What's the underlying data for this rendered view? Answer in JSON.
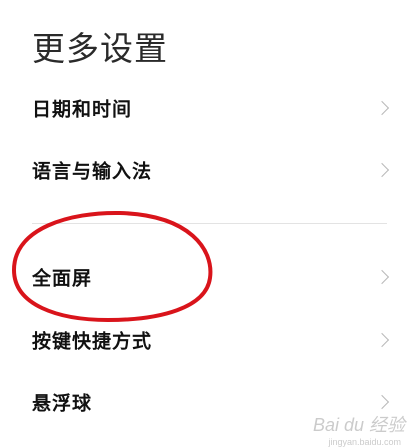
{
  "page": {
    "title": "更多设置"
  },
  "settings": {
    "items": [
      {
        "label": "日期和时间",
        "icon": "chevron-right-icon"
      },
      {
        "label": "语言与输入法",
        "icon": "chevron-right-icon"
      },
      {
        "label": "全面屏",
        "icon": "chevron-right-icon"
      },
      {
        "label": "按键快捷方式",
        "icon": "chevron-right-icon"
      },
      {
        "label": "悬浮球",
        "icon": "chevron-right-icon"
      }
    ]
  },
  "annotation": {
    "color": "#d9141b"
  },
  "watermark": {
    "logo_text": "Bai du 经验",
    "url_text": "jingyan.baidu.com"
  }
}
